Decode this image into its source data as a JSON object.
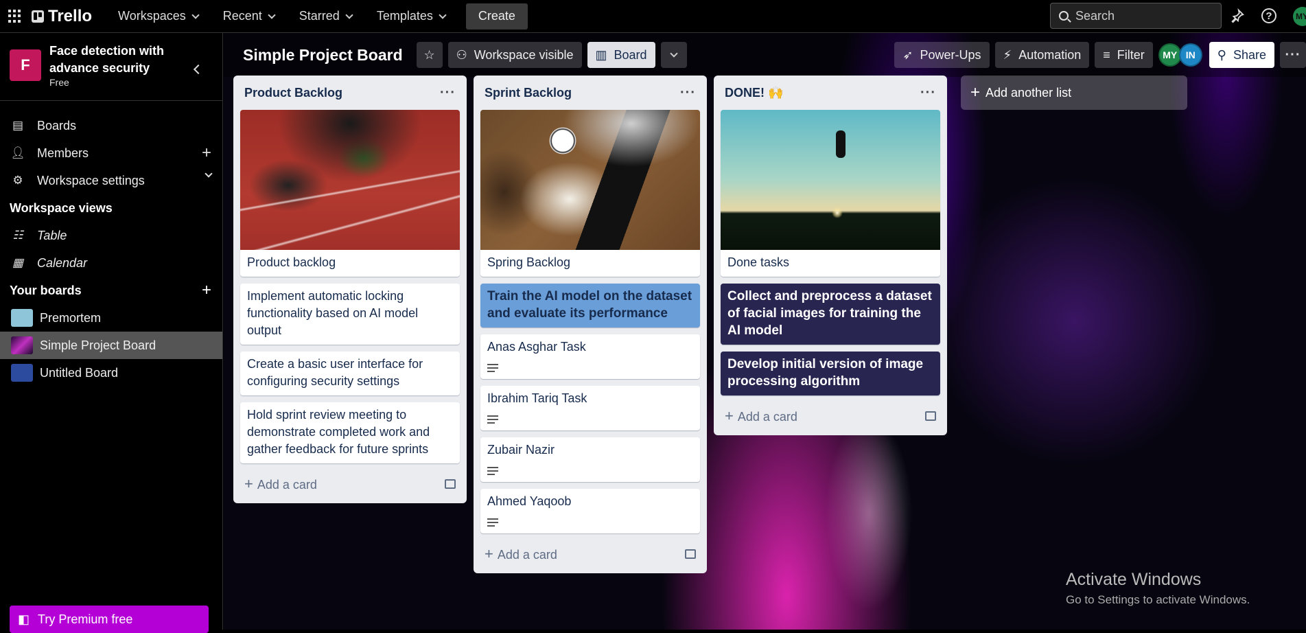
{
  "nav": {
    "logo": "Trello",
    "items": [
      "Workspaces",
      "Recent",
      "Starred",
      "Templates"
    ],
    "create": "Create",
    "search_placeholder": "Search",
    "user_initials": "MY"
  },
  "sidebar": {
    "workspace_letter": "F",
    "workspace_name": "Face detection with advance security",
    "workspace_plan": "Free",
    "items": [
      "Boards",
      "Members",
      "Workspace settings"
    ],
    "views_title": "Workspace views",
    "views": [
      "Table",
      "Calendar"
    ],
    "your_boards_title": "Your boards",
    "boards": [
      {
        "name": "Premortem",
        "color": "#8fc5d8"
      },
      {
        "name": "Simple Project Board",
        "color": "#5a2a6a"
      },
      {
        "name": "Untitled Board",
        "color": "#2c4a9e"
      }
    ],
    "premium": "Try Premium free"
  },
  "board": {
    "title": "Simple Project Board",
    "visibility": "Workspace visible",
    "view": "Board",
    "powerups": "Power-Ups",
    "automation": "Automation",
    "filter": "Filter",
    "members": [
      "MY",
      "IN"
    ],
    "share": "Share",
    "add_list": "Add another list",
    "lists": [
      {
        "title": "Product Backlog",
        "cover_card": "Product backlog",
        "cards": [
          "Implement automatic locking functionality based on AI model output",
          "Create a basic user interface for configuring security settings",
          "Hold sprint review meeting to demonstrate completed work and gather feedback for future sprints"
        ],
        "add": "Add a card"
      },
      {
        "title": "Sprint Backlog",
        "cover_card": "Spring Backlog",
        "highlight_card": "Train the AI model on the dataset and evaluate its performance",
        "cards": [
          "Anas Asghar Task",
          "Ibrahim Tariq Task",
          "Zubair Nazir",
          "Ahmed Yaqoob"
        ],
        "add": "Add a card"
      },
      {
        "title": "DONE! 🙌",
        "cover_card": "Done tasks",
        "cards": [
          "Collect and preprocess a dataset of facial images for training the AI model",
          "Develop initial version of image processing algorithm"
        ],
        "add": "Add a card"
      }
    ]
  },
  "watermark": {
    "title": "Activate Windows",
    "subtitle": "Go to Settings to activate Windows."
  },
  "colors": {
    "accent_workspace": "#c2185b",
    "premium": "#b400d6",
    "card_blue": "#6a9ed8",
    "card_navy": "#282551"
  }
}
